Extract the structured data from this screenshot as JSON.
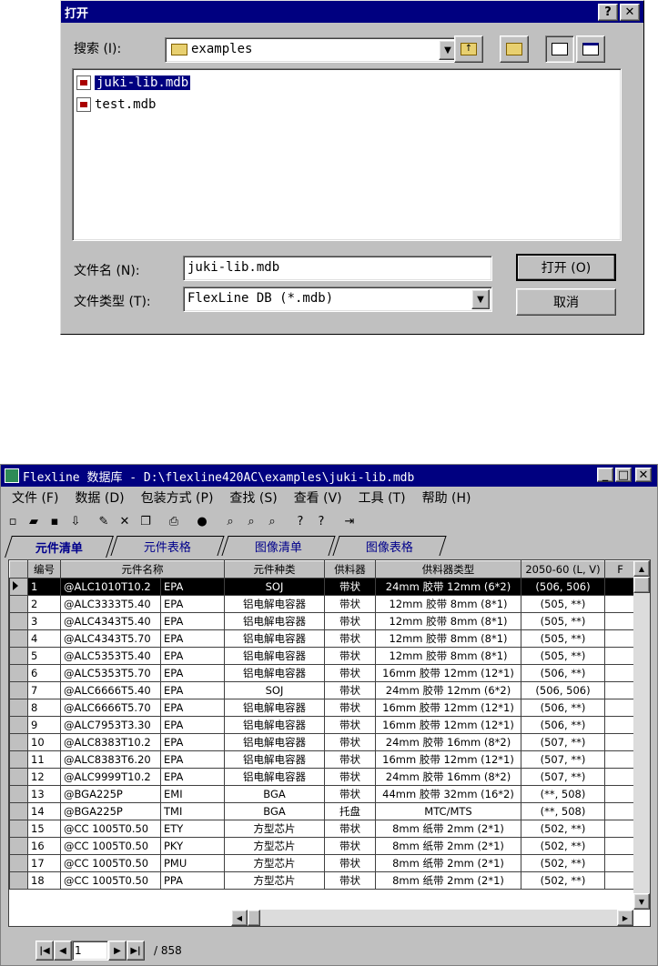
{
  "dialog": {
    "title": "打开",
    "help_btn": "?",
    "close_btn": "✕",
    "search_label": "搜索 (I):",
    "search_value": "examples",
    "files": [
      "juki-lib.mdb",
      "test.mdb"
    ],
    "filename_label": "文件名 (N):",
    "filename_value": "juki-lib.mdb",
    "filetype_label": "文件类型 (T):",
    "filetype_value": "FlexLine DB (*.mdb)",
    "open_btn": "打开 (O)",
    "cancel_btn": "取消"
  },
  "window": {
    "title": "Flexline 数据库 - D:\\flexline420AC\\examples\\juki-lib.mdb",
    "menu": [
      "文件 (F)",
      "数据 (D)",
      "包装方式 (P)",
      "查找 (S)",
      "查看 (V)",
      "工具 (T)",
      "帮助 (H)"
    ],
    "tabs": [
      "元件清单",
      "元件表格",
      "图像清单",
      "图像表格"
    ],
    "columns": [
      "编号",
      "元件名称",
      "元件种类",
      "供料器",
      "供料器类型",
      "2050-60 (L, V)",
      "F"
    ],
    "rows": [
      [
        "1",
        "@ALC1010T10.2",
        "EPA",
        "SOJ",
        "带状",
        "24mm 胶带 12mm (6*2)",
        "(506, 506)"
      ],
      [
        "2",
        "@ALC3333T5.40",
        "EPA",
        "铝电解电容器",
        "带状",
        "12mm 胶带 8mm (8*1)",
        "(505, **)"
      ],
      [
        "3",
        "@ALC4343T5.40",
        "EPA",
        "铝电解电容器",
        "带状",
        "12mm 胶带 8mm (8*1)",
        "(505, **)"
      ],
      [
        "4",
        "@ALC4343T5.70",
        "EPA",
        "铝电解电容器",
        "带状",
        "12mm 胶带 8mm (8*1)",
        "(505, **)"
      ],
      [
        "5",
        "@ALC5353T5.40",
        "EPA",
        "铝电解电容器",
        "带状",
        "12mm 胶带 8mm (8*1)",
        "(505, **)"
      ],
      [
        "6",
        "@ALC5353T5.70",
        "EPA",
        "铝电解电容器",
        "带状",
        "16mm 胶带 12mm (12*1)",
        "(506, **)"
      ],
      [
        "7",
        "@ALC6666T5.40",
        "EPA",
        "SOJ",
        "带状",
        "24mm 胶带 12mm (6*2)",
        "(506, 506)"
      ],
      [
        "8",
        "@ALC6666T5.70",
        "EPA",
        "铝电解电容器",
        "带状",
        "16mm 胶带 12mm (12*1)",
        "(506, **)"
      ],
      [
        "9",
        "@ALC7953T3.30",
        "EPA",
        "铝电解电容器",
        "带状",
        "16mm 胶带 12mm (12*1)",
        "(506, **)"
      ],
      [
        "10",
        "@ALC8383T10.2",
        "EPA",
        "铝电解电容器",
        "带状",
        "24mm 胶带 16mm (8*2)",
        "(507, **)"
      ],
      [
        "11",
        "@ALC8383T6.20",
        "EPA",
        "铝电解电容器",
        "带状",
        "16mm 胶带 12mm (12*1)",
        "(507, **)"
      ],
      [
        "12",
        "@ALC9999T10.2",
        "EPA",
        "铝电解电容器",
        "带状",
        "24mm 胶带 16mm (8*2)",
        "(507, **)"
      ],
      [
        "13",
        "@BGA225P",
        "EMI",
        "BGA",
        "带状",
        "44mm 胶带 32mm (16*2)",
        "(**, 508)"
      ],
      [
        "14",
        "@BGA225P",
        "TMI",
        "BGA",
        "托盘",
        "MTC/MTS",
        "(**, 508)"
      ],
      [
        "15",
        "@CC 1005T0.50",
        "ETY",
        "方型芯片",
        "带状",
        "8mm 纸带 2mm (2*1)",
        "(502, **)"
      ],
      [
        "16",
        "@CC 1005T0.50",
        "PKY",
        "方型芯片",
        "带状",
        "8mm 纸带 2mm (2*1)",
        "(502, **)"
      ],
      [
        "17",
        "@CC 1005T0.50",
        "PMU",
        "方型芯片",
        "带状",
        "8mm 纸带 2mm (2*1)",
        "(502, **)"
      ],
      [
        "18",
        "@CC 1005T0.50",
        "PPA",
        "方型芯片",
        "带状",
        "8mm 纸带 2mm (2*1)",
        "(502, **)"
      ]
    ],
    "record_value": "1",
    "record_total": "/ 858"
  },
  "colors": {
    "titlebar": "#000080",
    "face": "#c0c0c0",
    "tab_text": "#00008b"
  }
}
